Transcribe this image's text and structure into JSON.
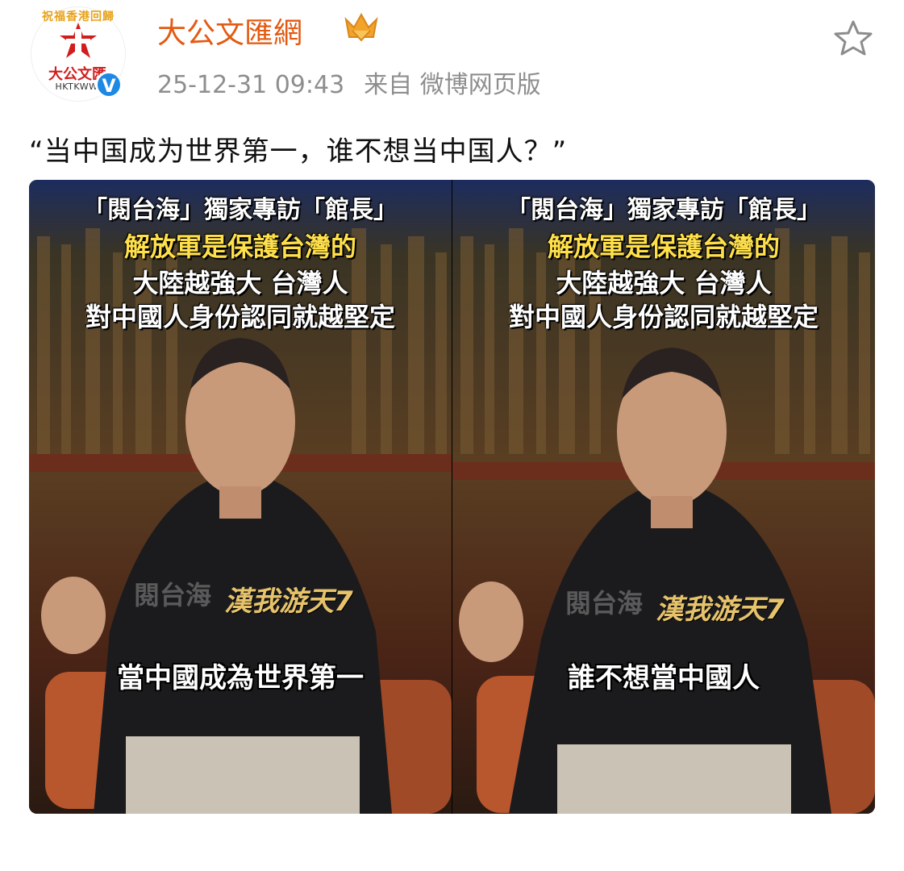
{
  "account": {
    "avatar_crest_text": "祝福香港回歸",
    "avatar_brand": "大公文匯",
    "avatar_brand_en": "HKTKWW",
    "username": "大公文匯網",
    "verified_mark": "V",
    "badge_icon": "crown-icon"
  },
  "post": {
    "timestamp": "25-12-31 09:43",
    "source": "来自 微博网页版",
    "text": "“当中国成为世界第一，谁不想当中国人？”",
    "favorite_icon": "star-icon"
  },
  "images": [
    {
      "headline_1": "「閱台海」獨家專訪「館長」",
      "headline_2": "解放軍是保護台灣的",
      "headline_3": "大陸越強大 台灣人",
      "headline_4": "對中國人身份認同就越堅定",
      "shirt_text": "漢我游天7",
      "watermark": "閱台海",
      "subtitle": "當中國成為世界第一"
    },
    {
      "headline_1": "「閱台海」獨家專訪「館長」",
      "headline_2": "解放軍是保護台灣的",
      "headline_3": "大陸越強大 台灣人",
      "headline_4": "對中國人身份認同就越堅定",
      "shirt_text": "漢我游天7",
      "watermark": "閱台海",
      "subtitle": "誰不想當中國人"
    }
  ],
  "colors": {
    "username": "#e35a12",
    "meta": "#8e8e8e",
    "verified": "#1e88e5",
    "headline_yellow": "#ffe04a"
  }
}
